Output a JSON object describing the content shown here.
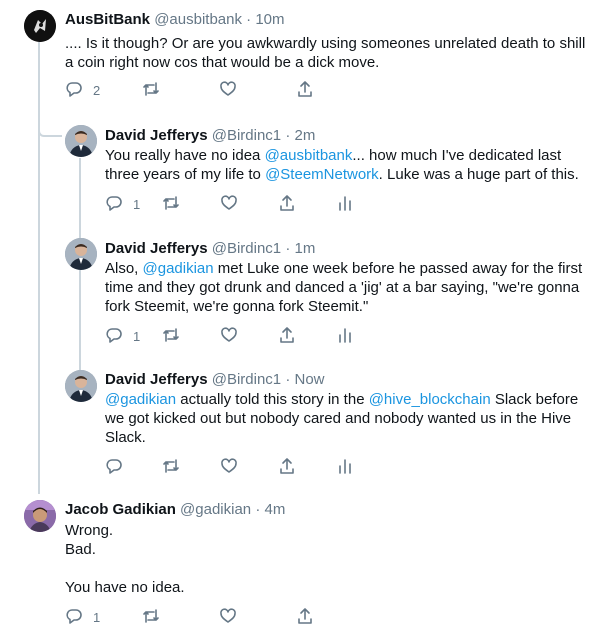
{
  "tweets": [
    {
      "name": "AusBitBank",
      "handle": "@ausbitbank",
      "sep": "·",
      "time": "10m",
      "lines": [
        [
          {
            "t": ".... Is it though? Or are you awkwardly using someones unrelated death to shill"
          }
        ],
        [
          {
            "t": "a coin right now cos that would be a dick move."
          }
        ]
      ],
      "replies": "2",
      "retweets": "",
      "likes": ""
    },
    {
      "name": "David Jefferys",
      "handle": "@Birdinc1",
      "sep": "·",
      "time": "2m",
      "lines": [
        [
          {
            "t": "You really have no idea "
          },
          {
            "m": "@ausbitbank"
          },
          {
            "t": "... how much I've dedicated last"
          }
        ],
        [
          {
            "t": "three years of my life to "
          },
          {
            "m": "@SteemNetwork"
          },
          {
            "t": ". Luke was a huge part of this."
          }
        ]
      ],
      "replies": "1",
      "retweets": "",
      "likes": ""
    },
    {
      "name": "David Jefferys",
      "handle": "@Birdinc1",
      "sep": "·",
      "time": "1m",
      "lines": [
        [
          {
            "t": "Also, "
          },
          {
            "m": "@gadikian"
          },
          {
            "t": " met Luke one week before he passed away for the first"
          }
        ],
        [
          {
            "t": "time and they got drunk and danced a 'jig' at a bar saying, \"we're gonna"
          }
        ],
        [
          {
            "t": "fork Steemit, we're gonna fork Steemit.\""
          }
        ]
      ],
      "replies": "1",
      "retweets": "",
      "likes": ""
    },
    {
      "name": "David Jefferys",
      "handle": "@Birdinc1",
      "sep": "·",
      "time": "Now",
      "lines": [
        [
          {
            "m": "@gadikian"
          },
          {
            "t": " actually told this story in the "
          },
          {
            "m": "@hive_blockchain"
          },
          {
            "t": " Slack before"
          }
        ],
        [
          {
            "t": "we got kicked out but nobody cared and nobody wanted us in the Hive"
          }
        ],
        [
          {
            "t": "Slack."
          }
        ]
      ],
      "replies": "",
      "retweets": "",
      "likes": ""
    },
    {
      "name": "Jacob Gadikian",
      "handle": "@gadikian",
      "sep": "·",
      "time": "4m",
      "lines": [
        [
          {
            "t": "Wrong."
          }
        ],
        [
          {
            "t": "Bad."
          }
        ],
        [
          {
            "t": ""
          }
        ],
        [
          {
            "t": "You have no idea."
          }
        ]
      ],
      "replies": "1",
      "retweets": "",
      "likes": ""
    }
  ],
  "icons": {
    "reply": "reply-icon",
    "retweet": "retweet-icon",
    "like": "heart-icon",
    "share": "share-icon",
    "analytics": "analytics-icon"
  },
  "colors": {
    "link": "#1b95e0",
    "muted": "#657786",
    "line": "#ccd6dd"
  }
}
